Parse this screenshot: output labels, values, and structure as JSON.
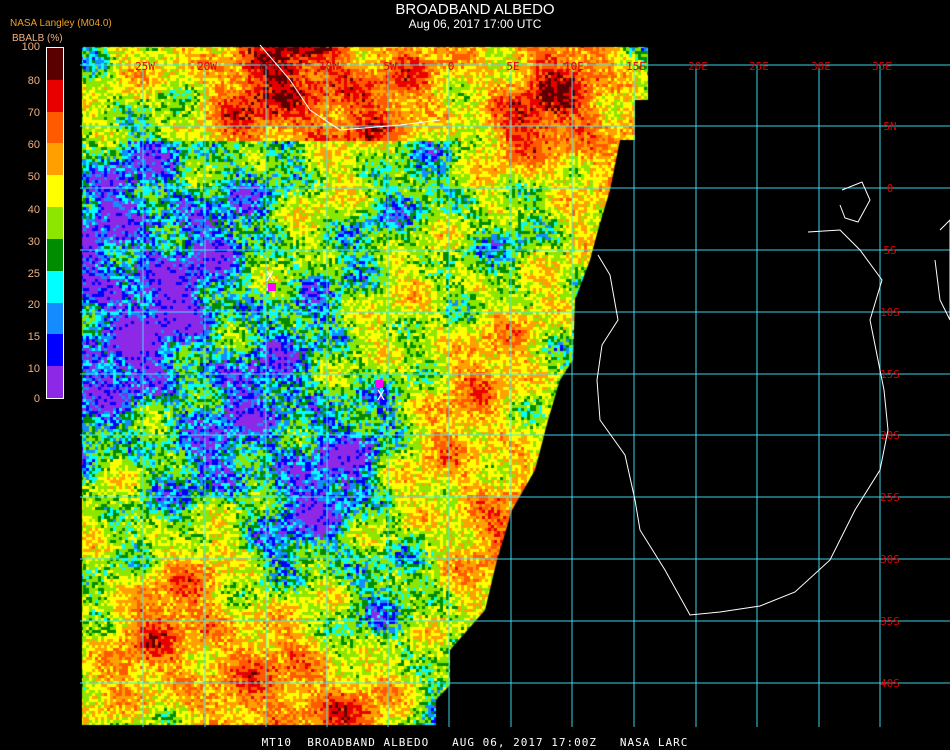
{
  "header": {
    "title": "BROADBAND ALBEDO",
    "subtitle": "Aug 06, 2017 17:00 UTC",
    "producer": "NASA Langley (M04.0)"
  },
  "legend": {
    "title": "BBALB (%)",
    "tick_labels": [
      "100",
      "80",
      "70",
      "60",
      "50",
      "40",
      "30",
      "25",
      "20",
      "15",
      "10",
      "0"
    ],
    "bins": [
      {
        "range": [
          80,
          100
        ],
        "color": "#5a0000"
      },
      {
        "range": [
          70,
          80
        ],
        "color": "#e80000"
      },
      {
        "range": [
          60,
          70
        ],
        "color": "#ff5a00"
      },
      {
        "range": [
          50,
          60
        ],
        "color": "#ffa000"
      },
      {
        "range": [
          40,
          50
        ],
        "color": "#ffff00"
      },
      {
        "range": [
          30,
          40
        ],
        "color": "#8ce600"
      },
      {
        "range": [
          25,
          30
        ],
        "color": "#008c00"
      },
      {
        "range": [
          20,
          25
        ],
        "color": "#00ffff"
      },
      {
        "range": [
          15,
          20
        ],
        "color": "#148cff"
      },
      {
        "range": [
          10,
          15
        ],
        "color": "#0000ff"
      },
      {
        "range": [
          0,
          10
        ],
        "color": "#8c28e6"
      }
    ]
  },
  "map": {
    "grid_color": "#40e8ff",
    "label_color": "#e00000",
    "coast_color": "#ffffff",
    "longitude_labels": [
      "25W",
      "20W",
      "15W",
      "10W",
      "5W",
      "0",
      "5E",
      "10E",
      "15E",
      "20E",
      "25E",
      "30E",
      "35E"
    ],
    "latitude_labels": [
      "5N",
      "0",
      "5S",
      "10S",
      "15S",
      "20S",
      "25S",
      "30S",
      "35S",
      "40S"
    ],
    "markers": [
      {
        "label": "X",
        "color": "#ff00ff"
      },
      {
        "label": "X",
        "color": "#ff00ff"
      }
    ]
  },
  "footer": "MT10  BROADBAND ALBEDO   AUG 06, 2017 17:00Z   NASA LARC"
}
